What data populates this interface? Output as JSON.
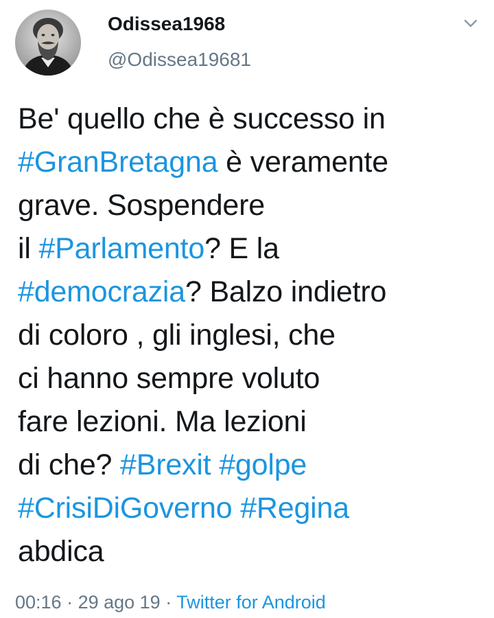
{
  "author": {
    "display_name": "Odissea1968",
    "handle": "@Odissea19681",
    "avatar_icon": "bearded-man-portrait"
  },
  "menu_icon": "chevron-down-icon",
  "tweet": {
    "lines": [
      [
        {
          "t": "Be' quello che è successo in",
          "tag": false
        }
      ],
      [
        {
          "t": "#GranBretagna",
          "tag": true
        },
        {
          "t": "  è veramente",
          "tag": false
        }
      ],
      [
        {
          "t": "grave. Sospendere",
          "tag": false
        }
      ],
      [
        {
          "t": "il ",
          "tag": false
        },
        {
          "t": "#Parlamento",
          "tag": true
        },
        {
          "t": "? E la",
          "tag": false
        }
      ],
      [
        {
          "t": "#democrazia",
          "tag": true
        },
        {
          "t": "? Balzo indietro",
          "tag": false
        }
      ],
      [
        {
          "t": "di coloro , gli inglesi, che",
          "tag": false
        }
      ],
      [
        {
          "t": "ci hanno sempre voluto",
          "tag": false
        }
      ],
      [
        {
          "t": "fare lezioni. Ma lezioni",
          "tag": false
        }
      ],
      [
        {
          "t": "di che? ",
          "tag": false
        },
        {
          "t": "#Brexit",
          "tag": true
        },
        {
          "t": " ",
          "tag": false
        },
        {
          "t": "#golpe",
          "tag": true
        }
      ],
      [
        {
          "t": "#CrisiDiGoverno",
          "tag": true
        },
        {
          "t": " ",
          "tag": false
        },
        {
          "t": "#Regina",
          "tag": true
        }
      ],
      [
        {
          "t": "abdica",
          "tag": false
        }
      ]
    ]
  },
  "meta": {
    "time": "00:16",
    "separator": " · ",
    "date": "29 ago 19",
    "source": "Twitter for Android"
  },
  "colors": {
    "text": "#14171a",
    "secondary": "#657786",
    "link": "#1b95e0"
  }
}
